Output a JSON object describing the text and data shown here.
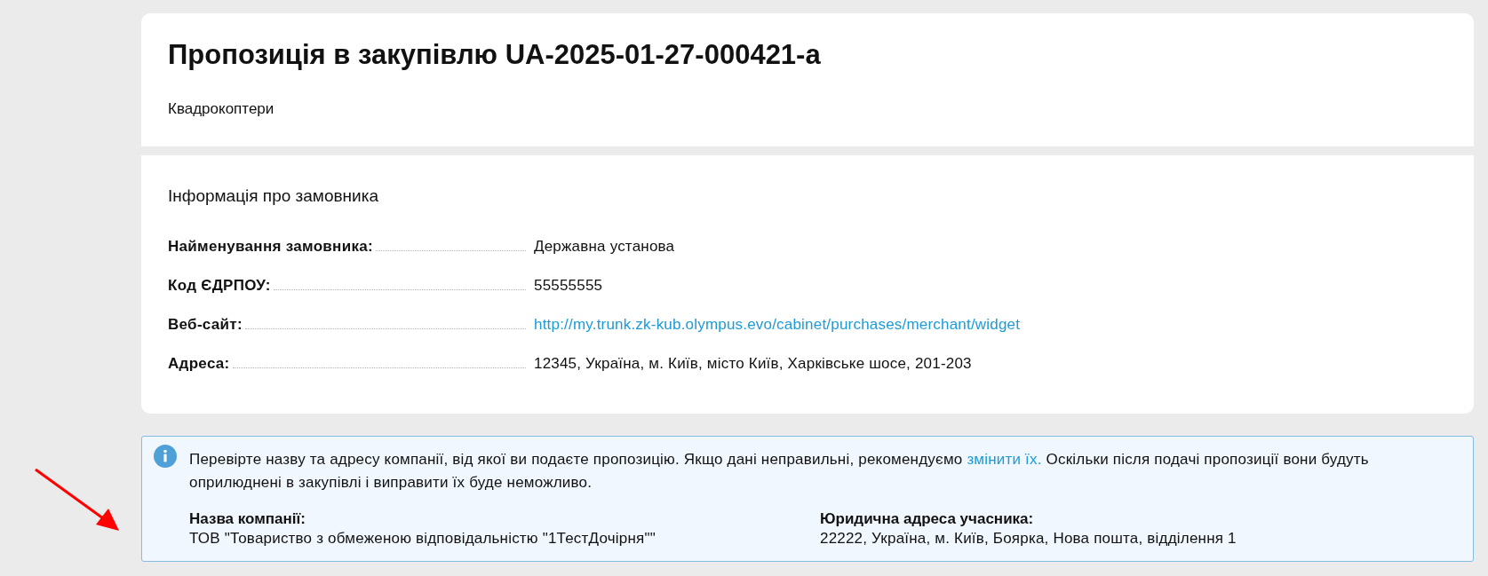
{
  "header": {
    "title": "Пропозиція в закупівлю UA-2025-01-27-000421-а",
    "subtitle": "Квадрокоптери"
  },
  "customer_info": {
    "heading": "Інформація про замовника",
    "fields": [
      {
        "label": "Найменування замовника:",
        "value": "Державна установа",
        "kind": "text"
      },
      {
        "label": "Код ЄДРПОУ:",
        "value": "55555555",
        "kind": "text"
      },
      {
        "label": "Веб-сайт:",
        "value": "http://my.trunk.zk-kub.olympus.evo/cabinet/purchases/merchant/widget",
        "kind": "link"
      },
      {
        "label": "Адреса:",
        "value": "12345, Україна, м. Київ, місто Київ, Харківське шосе, 201-203",
        "kind": "text"
      }
    ]
  },
  "notice": {
    "text_before": "Перевірте назву та адресу компанії, від якої ви подаєте пропозицію. Якщо дані неправильні, рекомендуємо",
    "link": "змінити їх.",
    "text_after": "Оскільки після подачі пропозиції вони будуть оприлюднені в закупівлі і виправити їх буде неможливо.",
    "details": [
      {
        "label": "Назва компанії:",
        "value": "ТОВ \"Товариство з обмеженою відповідальністю \"1ТестДочірня\"\""
      },
      {
        "label": "Юридична адреса учасника:",
        "value": "22222, Україна, м. Київ, Боярка, Нова пошта, відділення 1"
      }
    ]
  }
}
